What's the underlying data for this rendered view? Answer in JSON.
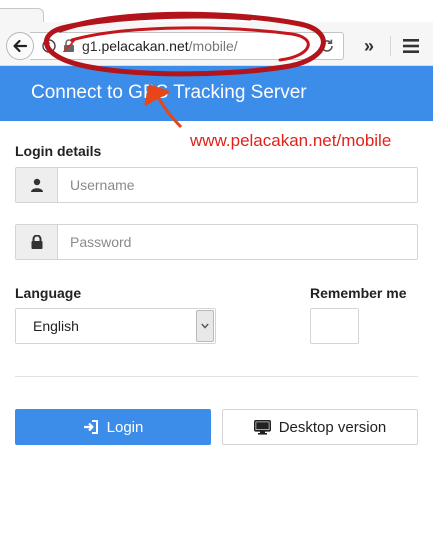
{
  "browser": {
    "url_prefix": "g1.",
    "url_host": "pelacakan.net",
    "url_path": "/mobile/",
    "overflow_label": "»"
  },
  "header": {
    "title": "Connect to GPS Tracking Server"
  },
  "annotation": {
    "caption": "www.pelacakan.net/mobile",
    "color": "#e0221b"
  },
  "form": {
    "login_details_label": "Login details",
    "username_placeholder": "Username",
    "username_value": "",
    "password_placeholder": "Password",
    "password_value": "",
    "language_label": "Language",
    "language_selected": "English",
    "remember_label": "Remember me",
    "login_button": "Login",
    "desktop_button": "Desktop version"
  },
  "icons": {
    "username": "user-icon",
    "password": "lock-icon",
    "login": "sign-in-icon",
    "desktop": "monitor-icon"
  },
  "colors": {
    "accent": "#3c8ce9",
    "annotation": "#e0221b"
  }
}
